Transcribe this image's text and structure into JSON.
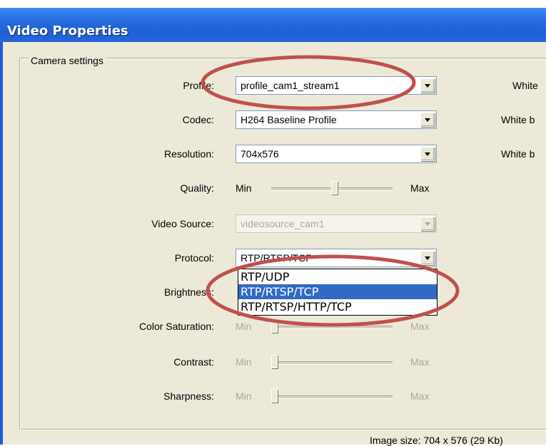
{
  "window": {
    "title": "Video Properties"
  },
  "group": {
    "legend": "Camera settings"
  },
  "fields": {
    "profile": {
      "label": "Profile:",
      "value": "profile_cam1_stream1"
    },
    "codec": {
      "label": "Codec:",
      "value": "H264 Baseline Profile"
    },
    "resolution": {
      "label": "Resolution:",
      "value": "704x576"
    },
    "quality": {
      "label": "Quality:",
      "min": "Min",
      "max": "Max",
      "level": 0.52
    },
    "video_source": {
      "label": "Video Source:",
      "value": "videosource_cam1"
    },
    "protocol": {
      "label": "Protocol:",
      "value": "RTP/RTSP/TCP"
    },
    "brightness": {
      "label": "Brightness:"
    },
    "color_saturation": {
      "label": "Color Saturation:",
      "min": "Min",
      "max": "Max",
      "level": 0.0
    },
    "contrast": {
      "label": "Contrast:",
      "min": "Min",
      "max": "Max",
      "level": 0.0
    },
    "sharpness": {
      "label": "Sharpness:",
      "min": "Min",
      "max": "Max",
      "level": 0.0
    }
  },
  "protocol_options": [
    "RTP/UDP",
    "RTP/RTSP/TCP",
    "RTP/RTSP/HTTP/TCP"
  ],
  "protocol_selected_index": 1,
  "right_column": [
    "White",
    "White b",
    "White b"
  ],
  "status": {
    "image_size": "Image size: 704 x 576 (29 Kb)"
  },
  "colors": {
    "title_bar": "#1f5fd6",
    "selection": "#316ac5",
    "annotation": "#c0504d"
  },
  "icons": {
    "combo_arrow": "chevron-down-icon"
  }
}
